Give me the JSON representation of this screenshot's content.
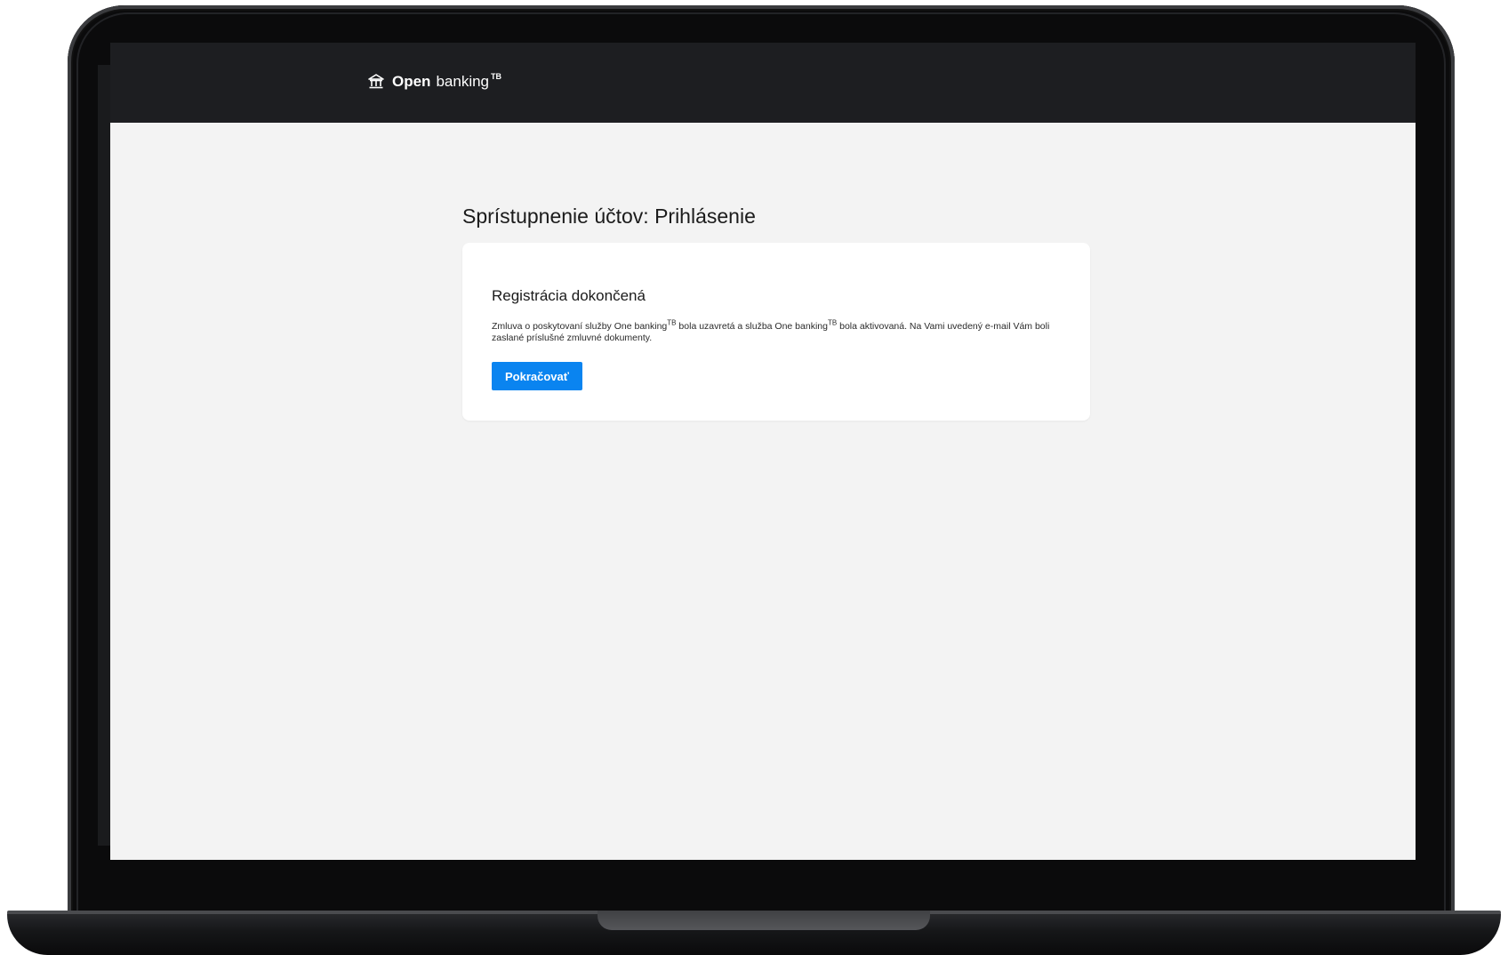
{
  "header": {
    "brand_strong": "Open",
    "brand_rest": "banking",
    "brand_sup": "TB",
    "icon": "bank-icon"
  },
  "main": {
    "title": "Sprístupnenie účtov: Prihlásenie",
    "card": {
      "title": "Registrácia dokončená",
      "text_part1": "Zmluva o poskytovaní služby One banking",
      "sup1": "TB",
      "text_part2": " bola uzavretá a služba One banking",
      "sup2": "TB",
      "text_part3": " bola aktivovaná. Na Vami uvedený e-mail Vám boli zaslané príslušné zmluvné dokumenty.",
      "button_label": "Pokračovať"
    }
  },
  "colors": {
    "header_bg": "#1d1e21",
    "page_bg": "#f3f3f3",
    "accent": "#0a84f0",
    "card_bg": "#ffffff"
  }
}
